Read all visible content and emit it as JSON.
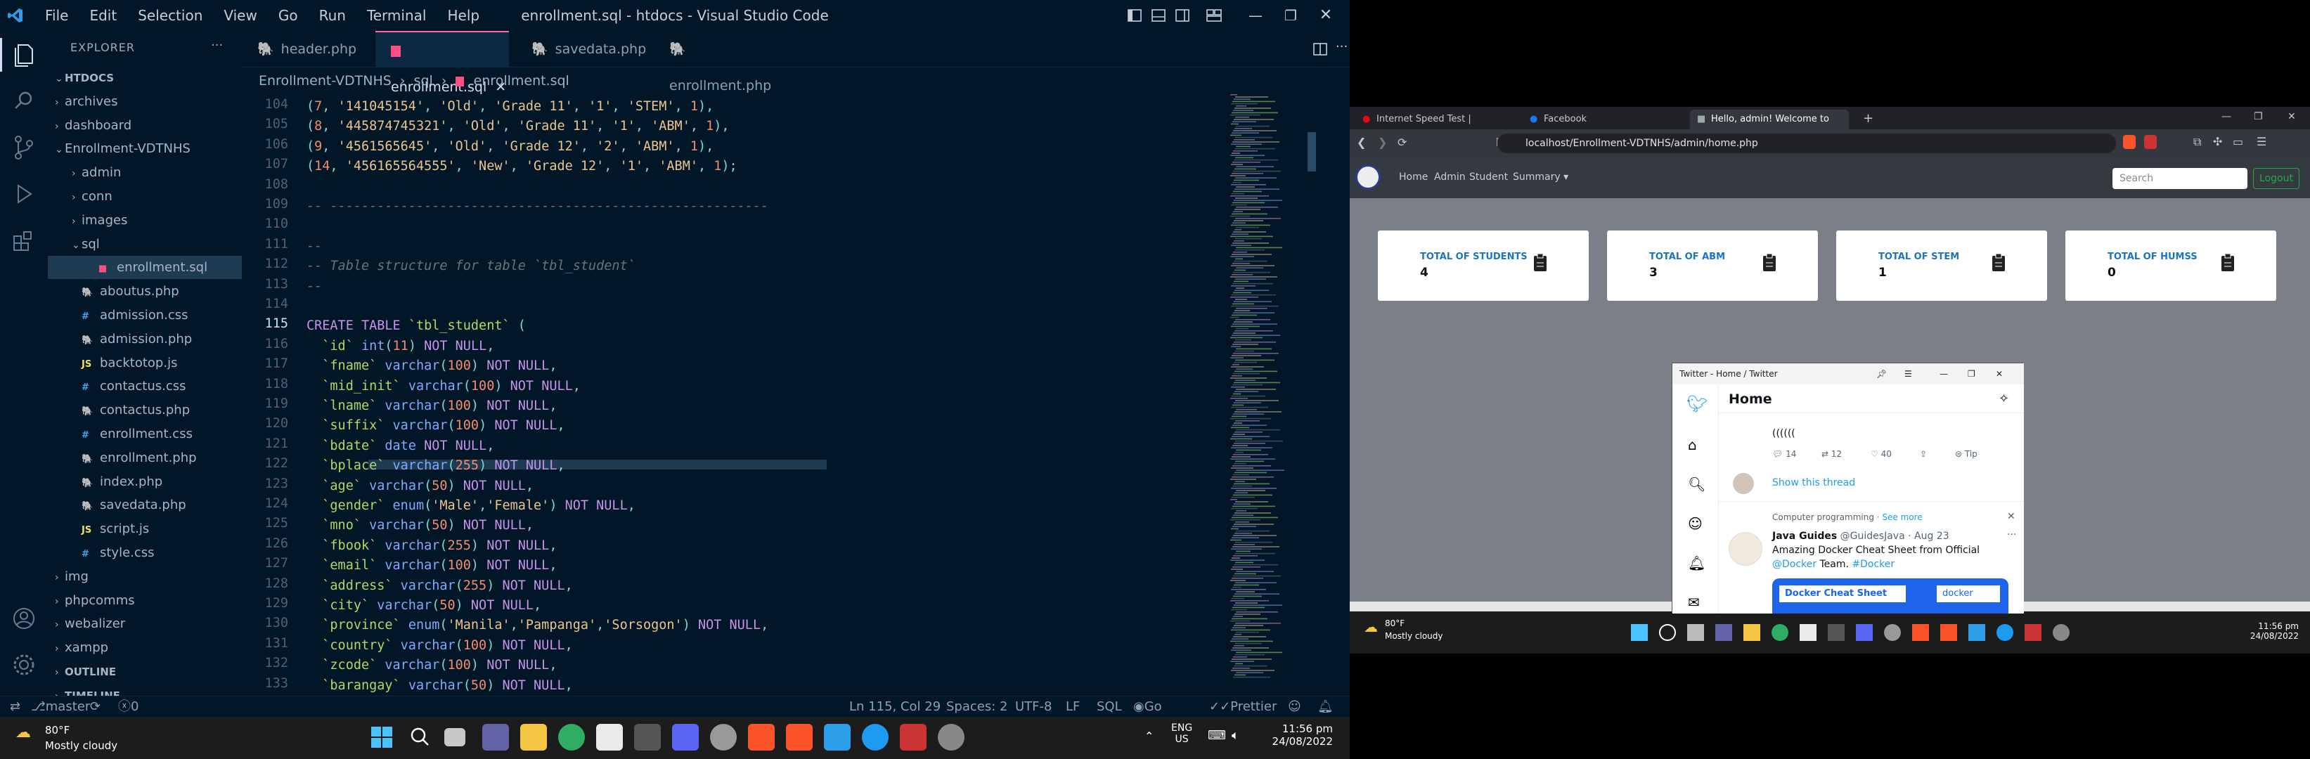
{
  "vscode": {
    "menu": [
      "File",
      "Edit",
      "Selection",
      "View",
      "Go",
      "Run",
      "Terminal",
      "Help"
    ],
    "window_title": "enrollment.sql - htdocs - Visual Studio Code",
    "explorer_label": "EXPLORER",
    "tree": [
      {
        "label": "HTDOCS",
        "type": "root"
      },
      {
        "label": "archives",
        "type": "folder"
      },
      {
        "label": "dashboard",
        "type": "folder"
      },
      {
        "label": "Enrollment-VDTNHS",
        "type": "folder-open"
      },
      {
        "label": "admin",
        "type": "folder"
      },
      {
        "label": "conn",
        "type": "folder"
      },
      {
        "label": "images",
        "type": "folder"
      },
      {
        "label": "sql",
        "type": "folder-open"
      },
      {
        "label": "enrollment.sql",
        "type": "sql"
      },
      {
        "label": "aboutus.php",
        "type": "php"
      },
      {
        "label": "admission.css",
        "type": "css"
      },
      {
        "label": "admission.php",
        "type": "php"
      },
      {
        "label": "backtotop.js",
        "type": "js"
      },
      {
        "label": "contactus.css",
        "type": "css"
      },
      {
        "label": "contactus.php",
        "type": "php"
      },
      {
        "label": "enrollment.css",
        "type": "css"
      },
      {
        "label": "enrollment.php",
        "type": "php"
      },
      {
        "label": "index.php",
        "type": "php"
      },
      {
        "label": "savedata.php",
        "type": "php"
      },
      {
        "label": "script.js",
        "type": "js"
      },
      {
        "label": "style.css",
        "type": "css"
      },
      {
        "label": "img",
        "type": "folder"
      },
      {
        "label": "phpcomms",
        "type": "folder"
      },
      {
        "label": "webalizer",
        "type": "folder"
      },
      {
        "label": "xampp",
        "type": "folder"
      },
      {
        "label": "OUTLINE",
        "type": "section"
      },
      {
        "label": "TIMELINE",
        "type": "section"
      }
    ],
    "tabs": [
      "header.php",
      "enrollment.sql",
      "savedata.php",
      "enrollment.php"
    ],
    "active_tab": "enrollment.sql",
    "breadcrumb": [
      "Enrollment-VDTNHS",
      "sql",
      "enrollment.sql"
    ],
    "line_numbers": [
      "104",
      "105",
      "106",
      "107",
      "108",
      "109",
      "110",
      "111",
      "112",
      "113",
      "114",
      "115",
      "116",
      "117",
      "118",
      "119",
      "120",
      "121",
      "122",
      "123",
      "124",
      "125",
      "126",
      "127",
      "128",
      "129",
      "130",
      "131",
      "132",
      "133"
    ],
    "current_line": "115",
    "code_lines": [
      "(7, '141045154', 'Old', 'Grade 11', '1', 'STEM', 1),",
      "(8, '445874745321', 'Old', 'Grade 11', '1', 'ABM', 1),",
      "(9, '4561565645', 'Old', 'Grade 12', '2', 'ABM', 1),",
      "(14, '456165564555', 'New', 'Grade 12', '1', 'ABM', 1);",
      "",
      "-- --------------------------------------------------------",
      "",
      "--",
      "-- Table structure for table `tbl_student`",
      "--",
      "",
      "CREATE TABLE `tbl_student` (",
      "  `id` int(11) NOT NULL,",
      "  `fname` varchar(100) NOT NULL,",
      "  `mid_init` varchar(100) NOT NULL,",
      "  `lname` varchar(100) NOT NULL,",
      "  `suffix` varchar(100) NOT NULL,",
      "  `bdate` date NOT NULL,",
      "  `bplace` varchar(255) NOT NULL,",
      "  `age` varchar(50) NOT NULL,",
      "  `gender` enum('Male','Female') NOT NULL,",
      "  `mno` varchar(50) NOT NULL,",
      "  `fbook` varchar(255) NOT NULL,",
      "  `email` varchar(100) NOT NULL,",
      "  `address` varchar(255) NOT NULL,",
      "  `city` varchar(50) NOT NULL,",
      "  `province` enum('Manila','Pampanga','Sorsogon') NOT NULL,",
      "  `country` varchar(100) NOT NULL,",
      "  `zcode` varchar(100) NOT NULL,",
      "  `barangay` varchar(50) NOT NULL,"
    ],
    "status": {
      "branch": "master",
      "problems": "0 ⚠ 0",
      "cursor": "Ln 115, Col 29",
      "spaces": "Spaces: 2",
      "encoding": "UTF-8",
      "eol": "LF",
      "language": "SQL",
      "golive": "Go Live",
      "prettier": "Prettier"
    }
  },
  "taskbar_left": {
    "weather_temp": "80°F",
    "weather_desc": "Mostly cloudy",
    "lang": "ENG",
    "region": "US",
    "time": "11:56 pm",
    "date": "24/08/2022"
  },
  "browser": {
    "tabs": [
      "Internet Speed Test | Fast.com",
      "Facebook",
      "Hello, admin! Welcome to Vicen"
    ],
    "url": "localhost/Enrollment-VDTNHS/admin/home.php",
    "nav": [
      "Home",
      "Admin",
      "Student",
      "Summary"
    ],
    "search_placeholder": "Search",
    "logout": "Logout",
    "cards": [
      {
        "title": "TOTAL OF STUDENTS",
        "value": "4"
      },
      {
        "title": "TOTAL OF ABM",
        "value": "3"
      },
      {
        "title": "TOTAL OF STEM",
        "value": "1"
      },
      {
        "title": "TOTAL OF HUMSS",
        "value": "0"
      }
    ]
  },
  "twitter": {
    "window_title": "Twitter - Home / Twitter",
    "home": "Home",
    "tweet_text": "((((((",
    "counts": [
      "14",
      "12",
      "40"
    ],
    "tip": "Tip",
    "show_thread": "Show this thread",
    "topic": "Computer programming",
    "see_more": "· See more",
    "author": "Java Guides",
    "handle": "@GuidesJava · Aug 23",
    "body": "Amazing Docker Cheat Sheet from Official",
    "body2_mention": "@Docker",
    "body2": "Team.",
    "hashtag": "#Docker",
    "card_title": "Docker Cheat Sheet",
    "card_logo": "docker"
  },
  "taskbar_right": {
    "weather_temp": "80°F",
    "weather_desc": "Mostly cloudy",
    "time": "11:56 pm",
    "date": "24/08/2022"
  }
}
